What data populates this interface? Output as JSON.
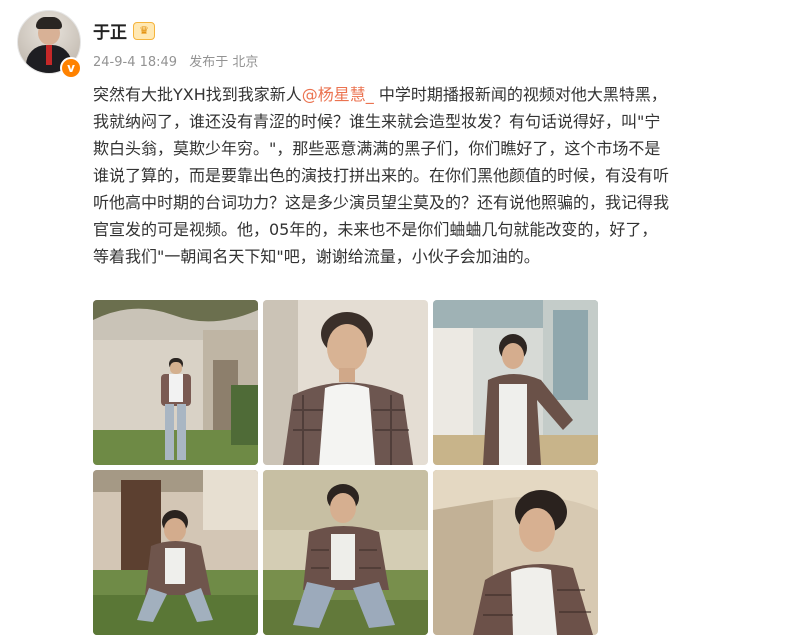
{
  "author": {
    "name": "于正",
    "badge_icon": "crown-icon",
    "verified_icon": "verified-v-icon",
    "verified_mark": "v"
  },
  "meta": {
    "timestamp": "24-9-4 18:49",
    "location": "发布于 北京"
  },
  "post": {
    "text_before": "突然有大批YXH找到我家新人",
    "mention": "@杨星慧_",
    "text_after": " 中学时期播报新闻的视频对他大黑特黑，\n我就纳闷了，谁还没有青涩的时候？谁生来就会造型妆发？有句话说得好，叫\"宁\n欺白头翁，莫欺少年穷。\"，那些恶意满满的黑子们，你们瞧好了，这个市场不是\n谁说了算的，而是要靠出色的演技打拼出来的。在你们黑他颜值的时候，有没有听\n听他高中时期的台词功力？这是多少演员望尘莫及的？还有说他照骗的，我记得我\n官宣发的可是视频。他，05年的，未来也不是你们蛐蛐几句就能改变的，好了，\n等着我们\"一朝闻名天下知\"吧，谢谢给流量，小伙子会加油的。"
  },
  "colors": {
    "mention": "#eb7350",
    "verified": "#ff8200",
    "meta": "#939393"
  },
  "photos": [
    {
      "scene": "standing by wall with tree"
    },
    {
      "scene": "portrait indoor"
    },
    {
      "scene": "leaning at window"
    },
    {
      "scene": "crouching on grass by door"
    },
    {
      "scene": "crouching on grass"
    },
    {
      "scene": "reclining close-up"
    }
  ]
}
